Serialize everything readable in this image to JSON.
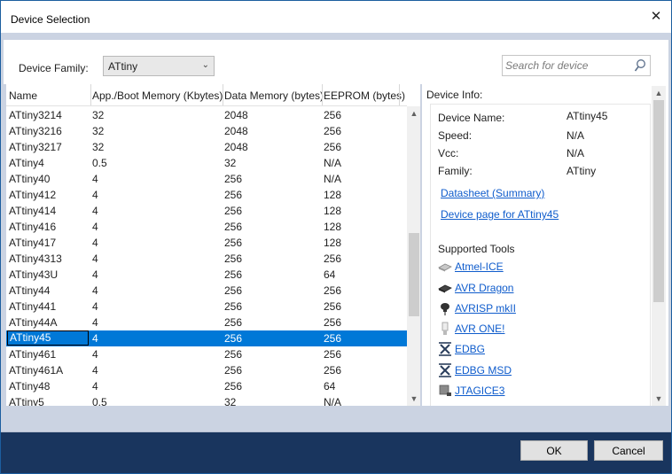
{
  "window": {
    "title": "Device Selection",
    "close_glyph": "✕"
  },
  "family": {
    "label": "Device Family:",
    "selected": "ATtiny",
    "chevron": "⌄"
  },
  "search": {
    "placeholder": "Search for device"
  },
  "columns": [
    "Name",
    "App./Boot Memory (Kbytes)",
    "Data Memory (bytes)",
    "EEPROM (bytes)"
  ],
  "devices": [
    [
      "ATtiny3214",
      "32",
      "2048",
      "256"
    ],
    [
      "ATtiny3216",
      "32",
      "2048",
      "256"
    ],
    [
      "ATtiny3217",
      "32",
      "2048",
      "256"
    ],
    [
      "ATtiny4",
      "0.5",
      "32",
      "N/A"
    ],
    [
      "ATtiny40",
      "4",
      "256",
      "N/A"
    ],
    [
      "ATtiny412",
      "4",
      "256",
      "128"
    ],
    [
      "ATtiny414",
      "4",
      "256",
      "128"
    ],
    [
      "ATtiny416",
      "4",
      "256",
      "128"
    ],
    [
      "ATtiny417",
      "4",
      "256",
      "128"
    ],
    [
      "ATtiny4313",
      "4",
      "256",
      "256"
    ],
    [
      "ATtiny43U",
      "4",
      "256",
      "64"
    ],
    [
      "ATtiny44",
      "4",
      "256",
      "256"
    ],
    [
      "ATtiny441",
      "4",
      "256",
      "256"
    ],
    [
      "ATtiny44A",
      "4",
      "256",
      "256"
    ],
    [
      "ATtiny45",
      "4",
      "256",
      "256"
    ],
    [
      "ATtiny461",
      "4",
      "256",
      "256"
    ],
    [
      "ATtiny461A",
      "4",
      "256",
      "256"
    ],
    [
      "ATtiny48",
      "4",
      "256",
      "64"
    ],
    [
      "ATtiny5",
      "0.5",
      "32",
      "N/A"
    ]
  ],
  "selected_index": 14,
  "device_info": {
    "title": "Device Info:",
    "name_label": "Device Name:",
    "name_value": "ATtiny45",
    "speed_label": "Speed:",
    "speed_value": "N/A",
    "vcc_label": "Vcc:",
    "vcc_value": "N/A",
    "family_label": "Family:",
    "family_value": "ATtiny",
    "datasheet_link": "Datasheet (Summary)",
    "device_page_link": "Device page for ATtiny45",
    "tools_heading": "Supported Tools",
    "tools": [
      {
        "name": "Atmel-ICE",
        "icon": "atmel-ice-icon"
      },
      {
        "name": "AVR Dragon",
        "icon": "avr-dragon-icon"
      },
      {
        "name": "AVRISP mkII",
        "icon": "avrisp-icon"
      },
      {
        "name": "AVR ONE!",
        "icon": "avr-one-icon"
      },
      {
        "name": "EDBG",
        "icon": "edbg-icon"
      },
      {
        "name": "EDBG MSD",
        "icon": "edbg-icon"
      },
      {
        "name": "JTAGICE3",
        "icon": "jtagice3-icon"
      }
    ]
  },
  "buttons": {
    "ok": "OK",
    "cancel": "Cancel"
  },
  "scrollbar": {
    "up": "▲",
    "down": "▼"
  },
  "colors": {
    "selection": "#0078d7",
    "footer": "#19355e",
    "link": "#0f5ccc"
  }
}
